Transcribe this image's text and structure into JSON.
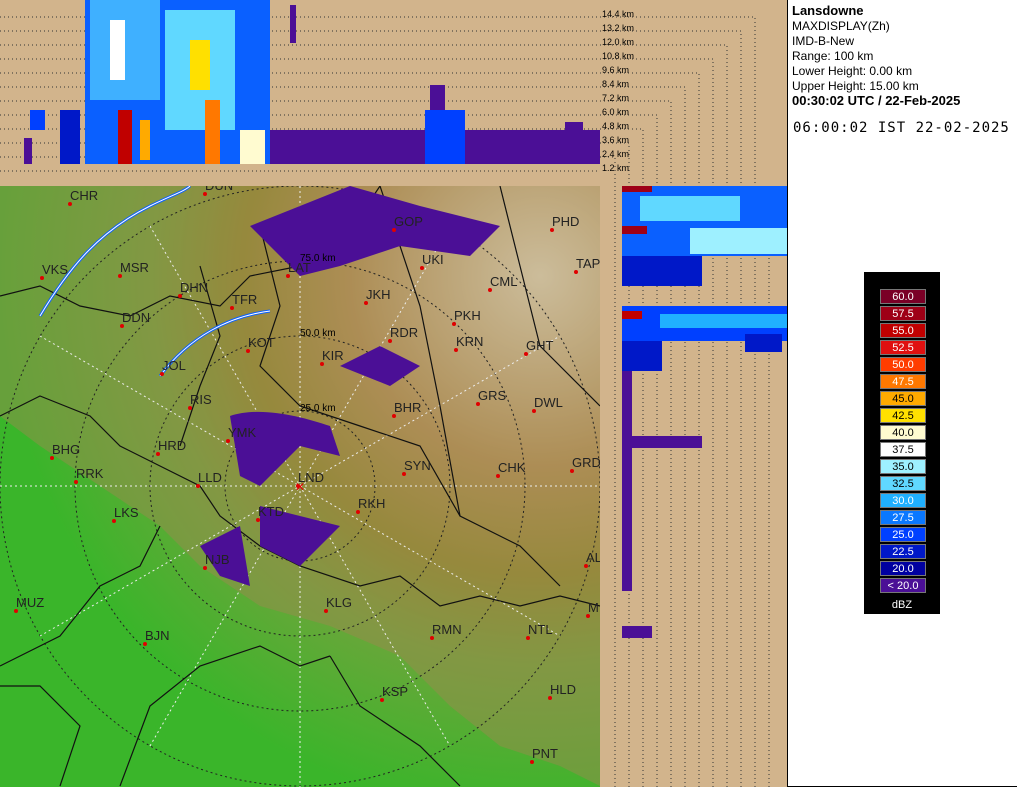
{
  "info": {
    "station": "Lansdowne",
    "product": "MAXDISPLAY(Zh)",
    "radar": "IMD-B-New",
    "range": "Range: 100 km",
    "lower_height": "Lower Height: 0.00 km",
    "upper_height": "Upper Height: 15.00 km",
    "utc": "00:30:02 UTC / 22-Feb-2025",
    "ist": "06:00:02 IST 22-02-2025"
  },
  "height_scale": [
    "14.4 km",
    "13.2 km",
    "12.0 km",
    "10.8 km",
    "9.6 km",
    "8.4 km",
    "7.2 km",
    "6.0 km",
    "4.8 km",
    "3.6 km",
    "2.4 km",
    "1.2 km"
  ],
  "range_labels": [
    "75.0 km",
    "50.0 km",
    "25.0 km"
  ],
  "places": [
    {
      "name": "CHR"
    },
    {
      "name": "DUN"
    },
    {
      "name": "VKS"
    },
    {
      "name": "MSR"
    },
    {
      "name": "DHN"
    },
    {
      "name": "LAT"
    },
    {
      "name": "TFR"
    },
    {
      "name": "DDN"
    },
    {
      "name": "KOT"
    },
    {
      "name": "JOL"
    },
    {
      "name": "KIR"
    },
    {
      "name": "RIS"
    },
    {
      "name": "BHG"
    },
    {
      "name": "HRD"
    },
    {
      "name": "YMK"
    },
    {
      "name": "RRK"
    },
    {
      "name": "LLD"
    },
    {
      "name": "LND"
    },
    {
      "name": "LKS"
    },
    {
      "name": "KTD"
    },
    {
      "name": "NJB"
    },
    {
      "name": "MUZ"
    },
    {
      "name": "BJN"
    },
    {
      "name": "KLG"
    },
    {
      "name": "RMN"
    },
    {
      "name": "NTL"
    },
    {
      "name": "KSP"
    },
    {
      "name": "HLD"
    },
    {
      "name": "PNT"
    },
    {
      "name": "AL"
    },
    {
      "name": "M"
    },
    {
      "name": "GRD"
    },
    {
      "name": "CHK"
    },
    {
      "name": "SYN"
    },
    {
      "name": "RKH"
    },
    {
      "name": "BHR"
    },
    {
      "name": "GRS"
    },
    {
      "name": "DWL"
    },
    {
      "name": "GHT"
    },
    {
      "name": "KRN"
    },
    {
      "name": "PKH"
    },
    {
      "name": "RDR"
    },
    {
      "name": "JKH"
    },
    {
      "name": "CML"
    },
    {
      "name": "UKI"
    },
    {
      "name": "GOP"
    },
    {
      "name": "PHD"
    },
    {
      "name": "TAP"
    }
  ],
  "colorbar": {
    "unit": "dBZ",
    "entries": [
      {
        "label": "60.0",
        "color": "#7a0026"
      },
      {
        "label": "57.5",
        "color": "#9e0016"
      },
      {
        "label": "55.0",
        "color": "#c00000"
      },
      {
        "label": "52.5",
        "color": "#e01010"
      },
      {
        "label": "50.0",
        "color": "#ff3c00"
      },
      {
        "label": "47.5",
        "color": "#ff7800"
      },
      {
        "label": "45.0",
        "color": "#ffaa00"
      },
      {
        "label": "42.5",
        "color": "#ffe000"
      },
      {
        "label": "40.0",
        "color": "#fffbd0"
      },
      {
        "label": "37.5",
        "color": "#ffffff"
      },
      {
        "label": "35.0",
        "color": "#9ef0ff"
      },
      {
        "label": "32.5",
        "color": "#60d8ff"
      },
      {
        "label": "30.0",
        "color": "#20b0ff"
      },
      {
        "label": "27.5",
        "color": "#0a78ff"
      },
      {
        "label": "25.0",
        "color": "#0040ff"
      },
      {
        "label": "22.5",
        "color": "#0018c8"
      },
      {
        "label": "20.0",
        "color": "#0000a0"
      },
      {
        "label": "< 20.0",
        "color": "#4b0f96"
      }
    ]
  }
}
